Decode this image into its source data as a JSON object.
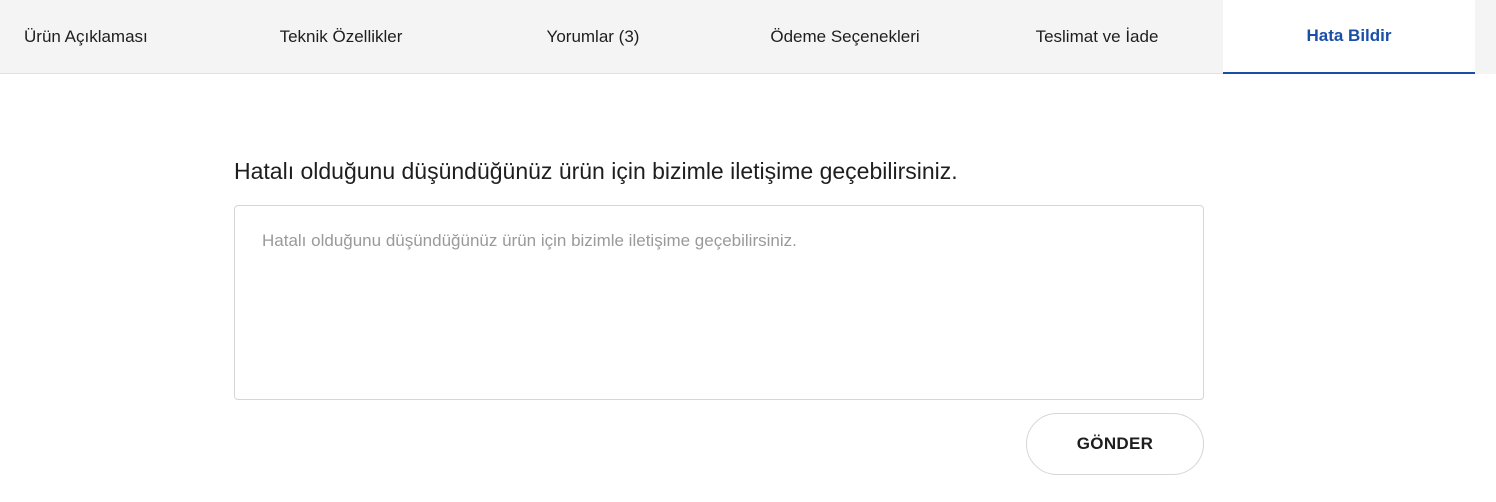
{
  "tabs": [
    {
      "label": "Ürün Açıklaması",
      "active": false
    },
    {
      "label": "Teknik Özellikler",
      "active": false
    },
    {
      "label": "Yorumlar (3)",
      "active": false
    },
    {
      "label": "Ödeme Seçenekleri",
      "active": false
    },
    {
      "label": "Teslimat ve İade",
      "active": false
    },
    {
      "label": "Hata Bildir",
      "active": true
    }
  ],
  "report": {
    "prompt": "Hatalı olduğunu düşündüğünüz ürün için bizimle iletişime geçebilirsiniz.",
    "textarea_value": "",
    "textarea_placeholder": "Hatalı olduğunu düşündüğünüz ürün için bizimle iletişime geçebilirsiniz.",
    "submit_label": "GÖNDER"
  },
  "colors": {
    "accent": "#1a4fa8",
    "tabbar_bg": "#f4f4f4",
    "border": "#d6d6d6",
    "placeholder": "#9a9a9a"
  }
}
